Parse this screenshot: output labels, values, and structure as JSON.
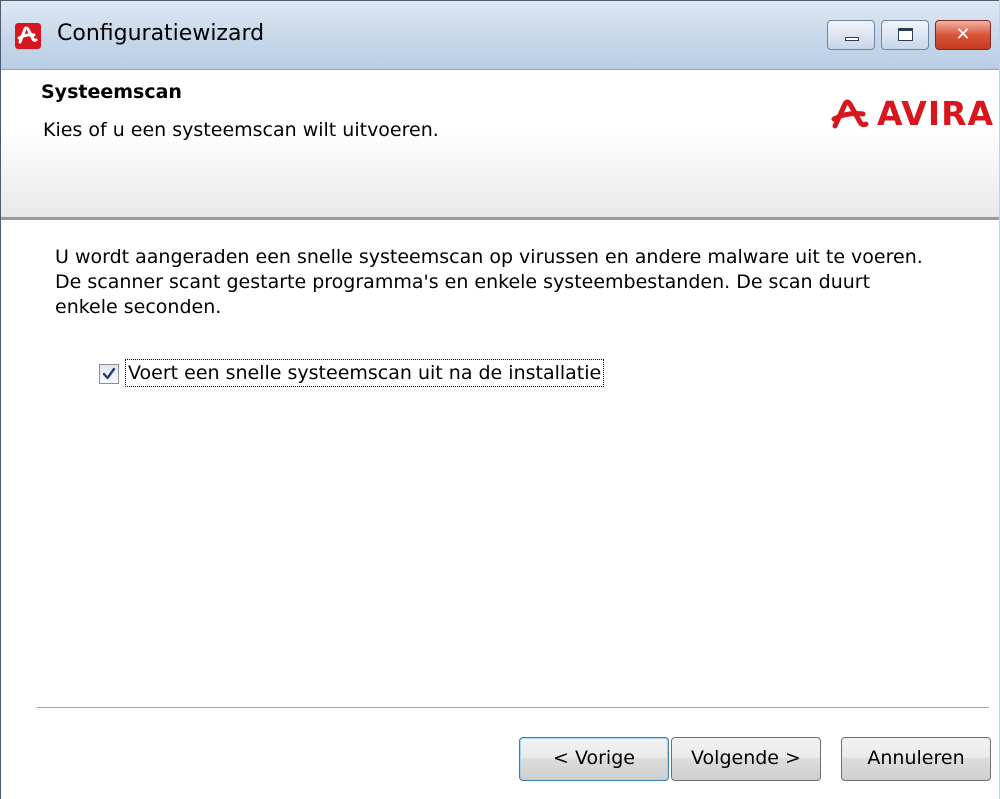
{
  "window": {
    "title": "Configuratiewizard",
    "icon": "avira-umbrella-icon",
    "caption_buttons": [
      "minimize",
      "maximize",
      "close"
    ],
    "close_glyph": "✕"
  },
  "header": {
    "title": "Systeemscan",
    "subtitle": "Kies of u een systeemscan wilt uitvoeren.",
    "logo_text": "AVIRA",
    "brand_color": "#d8161d"
  },
  "body": {
    "description": "U wordt aangeraden een snelle systeemscan op virussen en andere malware uit te voeren. De scanner scant gestarte programma's en enkele systeembestanden. De scan duurt enkele seconden.",
    "checkbox": {
      "label": "Voert een snelle systeemscan uit na de installatie",
      "checked": true
    }
  },
  "buttons": {
    "back": "< Vorige",
    "next": "Volgende >",
    "cancel": "Annuleren"
  }
}
